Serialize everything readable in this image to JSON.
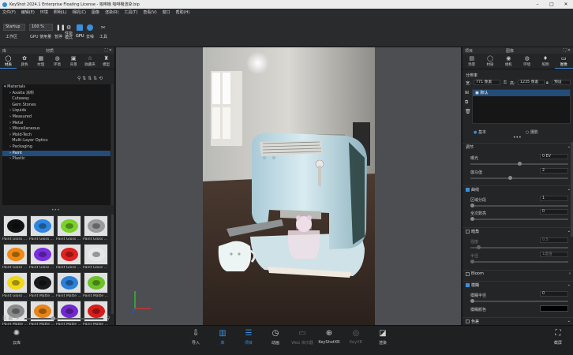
{
  "window": {
    "title": "KeyShot 2024.1 Enterprise Floating License - 咖啡機 咖啡機渲染.bip",
    "controls": [
      "–",
      "□",
      "✕"
    ]
  },
  "menu": [
    "文件(F)",
    "编辑(E)",
    "环境",
    "照明(L)",
    "相机(C)",
    "图像",
    "渲染(R)",
    "工具(T)",
    "查看(V)",
    "窗口",
    "帮助(H)"
  ],
  "toolbar": {
    "workspace_select": "Startup",
    "workspace_label": "工作区",
    "zoom_select": "100 %",
    "cpu_gpu_label": "GPU 使用量",
    "pause_label": "暂停",
    "perf_label": "性能\n模式",
    "gpu_label": "GPU",
    "denoise_label": "去噪",
    "tools_label": "工具"
  },
  "library": {
    "header": "库",
    "header_center": "材质",
    "tabs": [
      "材质",
      "颜色",
      "纹理",
      "环境",
      "背景",
      "收藏夹",
      "模型"
    ],
    "tree": [
      {
        "label": "Materials",
        "root": true
      },
      {
        "label": "Axalta 涂料"
      },
      {
        "label": "Cutaway"
      },
      {
        "label": "Gem Stones"
      },
      {
        "label": "Liquids"
      },
      {
        "label": "Measured"
      },
      {
        "label": "Metal"
      },
      {
        "label": "Miscellaneous"
      },
      {
        "label": "Mold-Tech"
      },
      {
        "label": "Multi-Layer Optics"
      },
      {
        "label": "Packaging"
      },
      {
        "label": "Paint",
        "selected": true
      },
      {
        "label": "Plastic"
      }
    ],
    "thumbnails": [
      {
        "label": "Paint Gloss ...",
        "color": "#111111"
      },
      {
        "label": "Paint Gloss ...",
        "color": "#2f86e0"
      },
      {
        "label": "Paint Gloss ...",
        "color": "#7ad22a"
      },
      {
        "label": "Paint Gloss ...",
        "color": "#9c9c9c"
      },
      {
        "label": "Paint Gloss ...",
        "color": "#f08a12"
      },
      {
        "label": "Paint Gloss ...",
        "color": "#7a2ee0"
      },
      {
        "label": "Paint Gloss ...",
        "color": "#e02020"
      },
      {
        "label": "Paint Gloss ...",
        "color": "#e8e8e8"
      },
      {
        "label": "Paint Gloss ...",
        "color": "#f0d818"
      },
      {
        "label": "Paint Matte ...",
        "color": "#1a1a1a"
      },
      {
        "label": "Paint Matte ...",
        "color": "#2b7fd8"
      },
      {
        "label": "Paint Matte ...",
        "color": "#6dc226"
      },
      {
        "label": "Paint Matte ...",
        "color": "#8a8a8a"
      },
      {
        "label": "Paint Matte ...",
        "color": "#e88418"
      },
      {
        "label": "Paint Matte ...",
        "color": "#7228d0"
      },
      {
        "label": "Paint Matte ...",
        "color": "#d81c1c"
      },
      {
        "label": "Paint Matte ...",
        "color": "#eeeeee"
      },
      {
        "label": "Paint Matte ...",
        "color": "#e8cc14"
      },
      {
        "label": "Paint Metal ...",
        "color": "#c9c9c9"
      },
      {
        "label": "Paint Metall ...",
        "color": "#2a2a2a"
      }
    ]
  },
  "right": {
    "header": "项目",
    "header_center": "图像",
    "tabs": [
      "场景",
      "材质",
      "相机",
      "环境",
      "照明",
      "图像"
    ],
    "resolution_label": "分辨率",
    "width_label": "宽:",
    "width_value": "771 像素",
    "height_label": "高:",
    "height_value": "1235 像素",
    "preset": "预设",
    "layer_name": "默认",
    "mode_basic": "基本",
    "mode_adv": "摄影",
    "adjust_title": "调节",
    "exposure_label": "曝光",
    "exposure_value": "0 EV",
    "gamma_label": "伽马值",
    "gamma_value": "2",
    "curve_title": "曲线",
    "sub1_label": "区域分段",
    "sub1_value": "1",
    "sub2_label": "全次数亮",
    "sub2_value": "0",
    "vignette_title": "暗角",
    "vig1_label": "强度",
    "vig1_value": "0.5",
    "vig2_label": "半径",
    "vig2_value": "1度值",
    "bloom_title": "Bloom",
    "blur_title": "模糊",
    "blur1_label": "模糊半径",
    "blur1_value": "0",
    "blur2_label": "模糊颜色",
    "last_title": "色差"
  },
  "bottom": {
    "left_btn": "云库",
    "buttons": [
      {
        "label": "导入",
        "icon": "⇩"
      },
      {
        "label": "库",
        "icon": "▥",
        "active": true
      },
      {
        "label": "项目",
        "icon": "☰",
        "active": true
      },
      {
        "label": "动画",
        "icon": "◷"
      },
      {
        "label": "Web 演示器",
        "icon": "▭",
        "dim": true
      },
      {
        "label": "KeyShotXR",
        "icon": "⊕"
      },
      {
        "label": "KeyVR",
        "icon": "◎",
        "dim": true
      },
      {
        "label": "渲染",
        "icon": "◪"
      }
    ],
    "right_btn": "截屏"
  },
  "colors": {
    "accent": "#3b8fdb",
    "panel": "#242527",
    "viewport": "#4d4e52"
  }
}
